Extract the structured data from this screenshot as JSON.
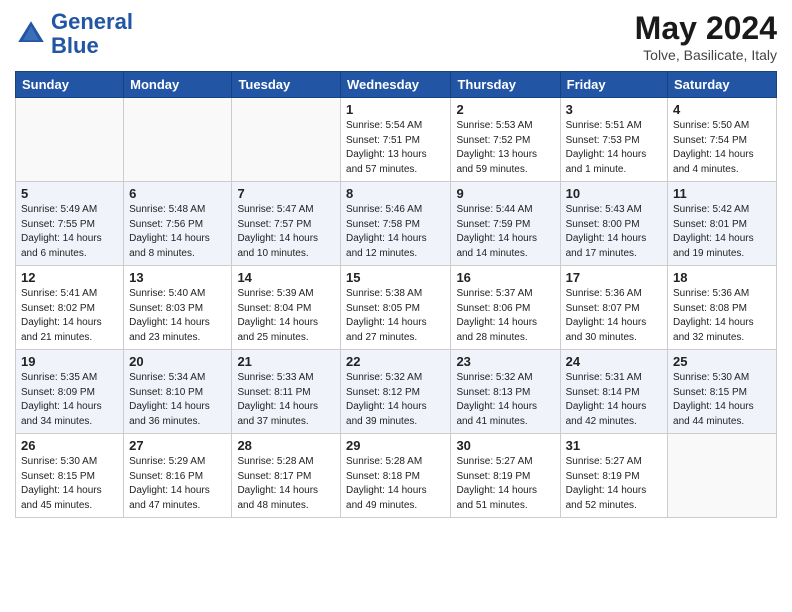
{
  "header": {
    "logo_general": "General",
    "logo_blue": "Blue",
    "month_year": "May 2024",
    "location": "Tolve, Basilicate, Italy"
  },
  "weekdays": [
    "Sunday",
    "Monday",
    "Tuesday",
    "Wednesday",
    "Thursday",
    "Friday",
    "Saturday"
  ],
  "weeks": [
    [
      {
        "day": "",
        "info": ""
      },
      {
        "day": "",
        "info": ""
      },
      {
        "day": "",
        "info": ""
      },
      {
        "day": "1",
        "info": "Sunrise: 5:54 AM\nSunset: 7:51 PM\nDaylight: 13 hours and 57 minutes."
      },
      {
        "day": "2",
        "info": "Sunrise: 5:53 AM\nSunset: 7:52 PM\nDaylight: 13 hours and 59 minutes."
      },
      {
        "day": "3",
        "info": "Sunrise: 5:51 AM\nSunset: 7:53 PM\nDaylight: 14 hours and 1 minute."
      },
      {
        "day": "4",
        "info": "Sunrise: 5:50 AM\nSunset: 7:54 PM\nDaylight: 14 hours and 4 minutes."
      }
    ],
    [
      {
        "day": "5",
        "info": "Sunrise: 5:49 AM\nSunset: 7:55 PM\nDaylight: 14 hours and 6 minutes."
      },
      {
        "day": "6",
        "info": "Sunrise: 5:48 AM\nSunset: 7:56 PM\nDaylight: 14 hours and 8 minutes."
      },
      {
        "day": "7",
        "info": "Sunrise: 5:47 AM\nSunset: 7:57 PM\nDaylight: 14 hours and 10 minutes."
      },
      {
        "day": "8",
        "info": "Sunrise: 5:46 AM\nSunset: 7:58 PM\nDaylight: 14 hours and 12 minutes."
      },
      {
        "day": "9",
        "info": "Sunrise: 5:44 AM\nSunset: 7:59 PM\nDaylight: 14 hours and 14 minutes."
      },
      {
        "day": "10",
        "info": "Sunrise: 5:43 AM\nSunset: 8:00 PM\nDaylight: 14 hours and 17 minutes."
      },
      {
        "day": "11",
        "info": "Sunrise: 5:42 AM\nSunset: 8:01 PM\nDaylight: 14 hours and 19 minutes."
      }
    ],
    [
      {
        "day": "12",
        "info": "Sunrise: 5:41 AM\nSunset: 8:02 PM\nDaylight: 14 hours and 21 minutes."
      },
      {
        "day": "13",
        "info": "Sunrise: 5:40 AM\nSunset: 8:03 PM\nDaylight: 14 hours and 23 minutes."
      },
      {
        "day": "14",
        "info": "Sunrise: 5:39 AM\nSunset: 8:04 PM\nDaylight: 14 hours and 25 minutes."
      },
      {
        "day": "15",
        "info": "Sunrise: 5:38 AM\nSunset: 8:05 PM\nDaylight: 14 hours and 27 minutes."
      },
      {
        "day": "16",
        "info": "Sunrise: 5:37 AM\nSunset: 8:06 PM\nDaylight: 14 hours and 28 minutes."
      },
      {
        "day": "17",
        "info": "Sunrise: 5:36 AM\nSunset: 8:07 PM\nDaylight: 14 hours and 30 minutes."
      },
      {
        "day": "18",
        "info": "Sunrise: 5:36 AM\nSunset: 8:08 PM\nDaylight: 14 hours and 32 minutes."
      }
    ],
    [
      {
        "day": "19",
        "info": "Sunrise: 5:35 AM\nSunset: 8:09 PM\nDaylight: 14 hours and 34 minutes."
      },
      {
        "day": "20",
        "info": "Sunrise: 5:34 AM\nSunset: 8:10 PM\nDaylight: 14 hours and 36 minutes."
      },
      {
        "day": "21",
        "info": "Sunrise: 5:33 AM\nSunset: 8:11 PM\nDaylight: 14 hours and 37 minutes."
      },
      {
        "day": "22",
        "info": "Sunrise: 5:32 AM\nSunset: 8:12 PM\nDaylight: 14 hours and 39 minutes."
      },
      {
        "day": "23",
        "info": "Sunrise: 5:32 AM\nSunset: 8:13 PM\nDaylight: 14 hours and 41 minutes."
      },
      {
        "day": "24",
        "info": "Sunrise: 5:31 AM\nSunset: 8:14 PM\nDaylight: 14 hours and 42 minutes."
      },
      {
        "day": "25",
        "info": "Sunrise: 5:30 AM\nSunset: 8:15 PM\nDaylight: 14 hours and 44 minutes."
      }
    ],
    [
      {
        "day": "26",
        "info": "Sunrise: 5:30 AM\nSunset: 8:15 PM\nDaylight: 14 hours and 45 minutes."
      },
      {
        "day": "27",
        "info": "Sunrise: 5:29 AM\nSunset: 8:16 PM\nDaylight: 14 hours and 47 minutes."
      },
      {
        "day": "28",
        "info": "Sunrise: 5:28 AM\nSunset: 8:17 PM\nDaylight: 14 hours and 48 minutes."
      },
      {
        "day": "29",
        "info": "Sunrise: 5:28 AM\nSunset: 8:18 PM\nDaylight: 14 hours and 49 minutes."
      },
      {
        "day": "30",
        "info": "Sunrise: 5:27 AM\nSunset: 8:19 PM\nDaylight: 14 hours and 51 minutes."
      },
      {
        "day": "31",
        "info": "Sunrise: 5:27 AM\nSunset: 8:19 PM\nDaylight: 14 hours and 52 minutes."
      },
      {
        "day": "",
        "info": ""
      }
    ]
  ]
}
